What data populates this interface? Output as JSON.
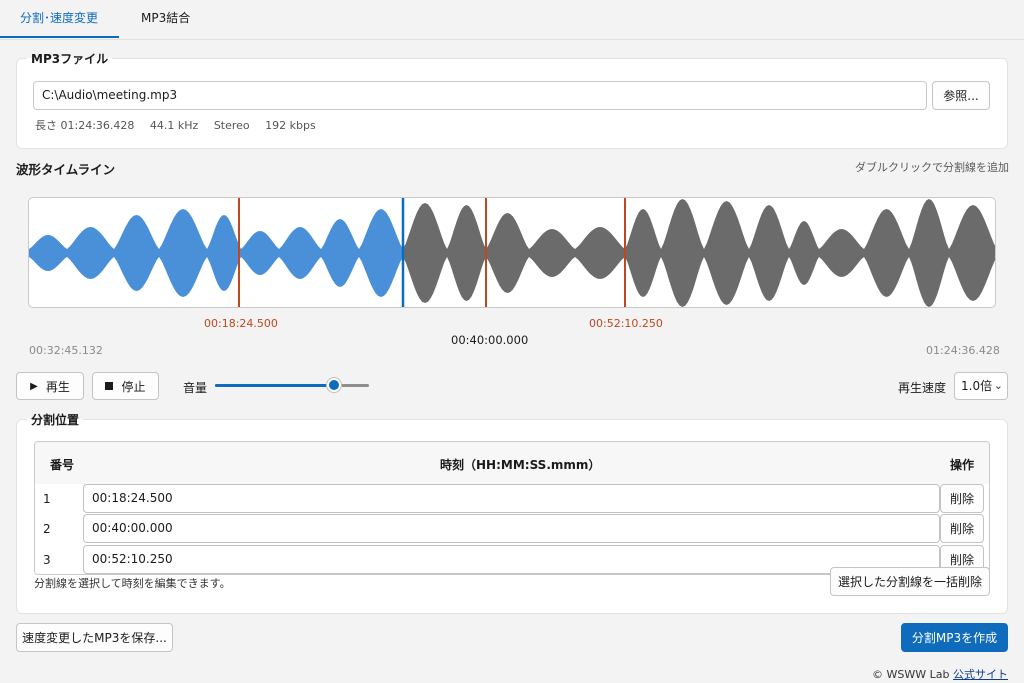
{
  "tabs": [
    {
      "label": "分割･速度変更",
      "active": true
    },
    {
      "label": "MP3結合",
      "active": false
    }
  ],
  "file_group": {
    "legend": "MP3ファイル",
    "path": "C:\\Audio\\meeting.mp3",
    "browse_label": "参照...",
    "meta": {
      "length": "長さ 01:24:36.428",
      "sample_rate": "44.1 kHz",
      "channels": "Stereo",
      "bitrate": "192 kbps"
    }
  },
  "timeline": {
    "title": "波形タイムライン",
    "hint": "ダブルクリックで分割線を追加",
    "view_start": "00:32:45.132",
    "view_end": "01:24:36.428",
    "cursor_time": "00:40:00.000",
    "markers": [
      "00:18:24.500",
      "00:52:10.250"
    ]
  },
  "controls": {
    "play_label": "再生",
    "stop_label": "停止",
    "volume_label": "音量",
    "volume_level": 0.77,
    "speed_label": "再生速度",
    "speed_value": "1.0倍"
  },
  "split_group": {
    "legend": "分割位置",
    "columns": {
      "num": "番号",
      "time": "時刻（HH:MM:SS.mmm）",
      "action": "操作"
    },
    "rows": [
      {
        "num": "1",
        "time": "00:18:24.500",
        "delete": "削除"
      },
      {
        "num": "2",
        "time": "00:40:00.000",
        "delete": "削除"
      },
      {
        "num": "3",
        "time": "00:52:10.250",
        "delete": "削除"
      }
    ],
    "note": "分割線を選択して時刻を編集できます。",
    "bulk_delete_label": "選択した分割線を一括削除"
  },
  "footer": {
    "save_speed_label": "速度変更したMP3を保存...",
    "create_label": "分割MP3を作成",
    "copyright": "© WSWW Lab",
    "site_link": "公式サイト"
  },
  "colors": {
    "accent": "#0f6cbd",
    "played_wave": "#4a90d9",
    "unplayed_wave": "#6b6b6b",
    "marker": "#c0471e"
  }
}
